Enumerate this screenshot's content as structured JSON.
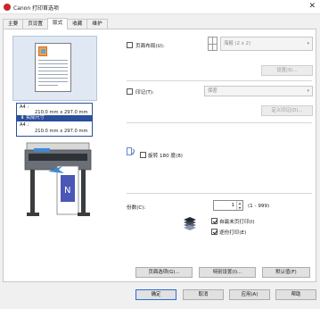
{
  "window": {
    "title": "Canon         打印首选项",
    "close": "✕"
  },
  "tabs": [
    {
      "label": "主要"
    },
    {
      "label": "页设置"
    },
    {
      "label": "版式"
    },
    {
      "label": "收藏"
    },
    {
      "label": "维护"
    }
  ],
  "preview": {
    "paper_label": "A4 :",
    "paper_dims": "210.0 mm x 297.0 mm",
    "scale_label": "实际尺寸",
    "output_label": "A4 :",
    "output_dims": "210.0 mm x 297.0 mm"
  },
  "layout": {
    "page_layout_label": "页面布局(U):",
    "page_layout_checked": false,
    "page_layout_value": "海报 (2 x 2)",
    "settings_button": "设置(S)...",
    "stamp_label": "印记(T):",
    "stamp_checked": false,
    "stamp_value": "保密",
    "define_stamp_button": "定义印记(D)...",
    "rotate_label": "旋转 180 度(8)",
    "rotate_checked": false,
    "copies_label": "份数(C):",
    "copies_value": "1",
    "copies_range": "(1 - 999)",
    "last_page_first_label": "自最末页打印(I)",
    "last_page_first_checked": true,
    "collate_label": "逐份打印(E)",
    "collate_checked": true
  },
  "bottom_buttons": {
    "page_options": "页面选项(G)...",
    "special_settings": "特别设置(I)...",
    "defaults": "默认值(F)"
  },
  "dialog_buttons": {
    "ok": "确定",
    "cancel": "取消",
    "apply": "应用(A)",
    "help": "帮助"
  },
  "colors": {
    "accent": "#2b4f9a",
    "brand": "#c8262c"
  }
}
